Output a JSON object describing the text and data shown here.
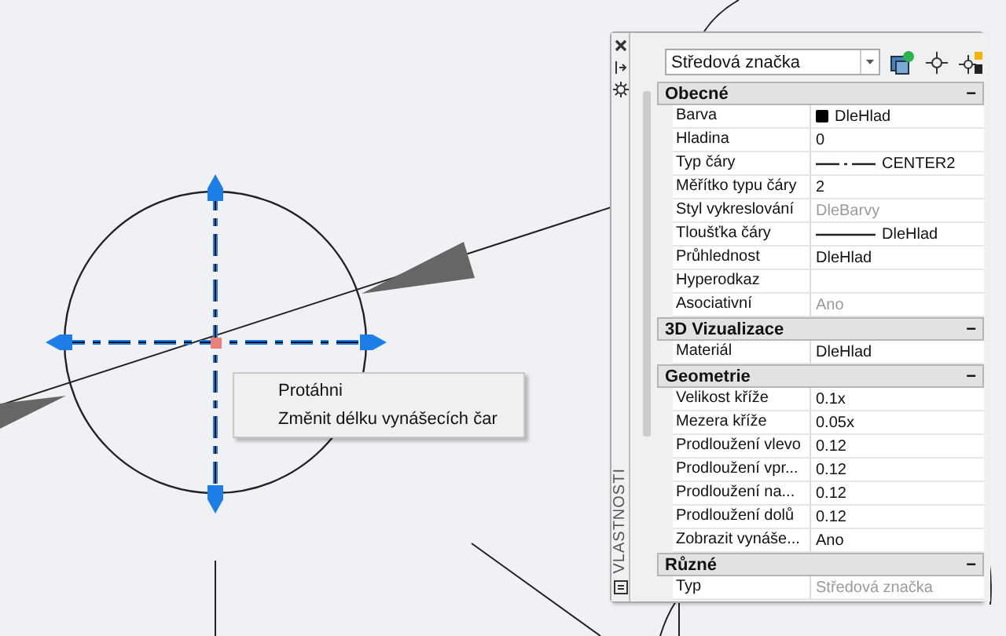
{
  "context_menu": {
    "items": [
      {
        "label": "Protáhni"
      },
      {
        "label": "Změnit délku vynášecích čar"
      }
    ]
  },
  "palette": {
    "title": "VLASTNOSTI",
    "object_type": "Středová značka",
    "sections": [
      {
        "title": "Obecné",
        "toggle": "−",
        "rows": [
          {
            "label": "Barva",
            "value": "DleHlad",
            "kind": "swatch",
            "disabled": false
          },
          {
            "label": "Hladina",
            "value": "0",
            "kind": "plain",
            "disabled": false
          },
          {
            "label": "Typ čáry",
            "value": "CENTER2",
            "kind": "linetype",
            "disabled": false
          },
          {
            "label": "Měřítko typu čáry",
            "value": "2",
            "kind": "plain",
            "disabled": false
          },
          {
            "label": "Styl vykreslování",
            "value": "DleBarvy",
            "kind": "plain",
            "disabled": true
          },
          {
            "label": "Tloušťka čáry",
            "value": "DleHlad",
            "kind": "lineweight",
            "disabled": false
          },
          {
            "label": "Průhlednost",
            "value": "DleHlad",
            "kind": "plain",
            "disabled": false
          },
          {
            "label": "Hyperodkaz",
            "kind": "plain"
          },
          {
            "label": "Asociativní",
            "value": "Ano",
            "kind": "plain",
            "disabled": true
          }
        ]
      },
      {
        "title": "3D Vizualizace",
        "toggle": "−",
        "rows": [
          {
            "label": "Materiál",
            "value": "DleHlad",
            "kind": "plain",
            "disabled": false
          }
        ]
      },
      {
        "title": "Geometrie",
        "toggle": "−",
        "rows": [
          {
            "label": "Velikost kříže",
            "value": "0.1x",
            "kind": "plain",
            "disabled": false
          },
          {
            "label": "Mezera kříže",
            "value": "0.05x",
            "kind": "plain",
            "disabled": false
          },
          {
            "label": "Prodloužení vlevo",
            "value": "0.12",
            "kind": "plain",
            "disabled": false
          },
          {
            "label": "Prodloužení vpr...",
            "value": "0.12",
            "kind": "plain",
            "disabled": false
          },
          {
            "label": "Prodloužení na...",
            "value": "0.12",
            "kind": "plain",
            "disabled": false
          },
          {
            "label": "Prodloužení dolů",
            "value": "0.12",
            "kind": "plain",
            "disabled": false
          },
          {
            "label": "Zobrazit vynáše...",
            "value": "Ano",
            "kind": "plain",
            "disabled": false
          }
        ]
      },
      {
        "title": "Různé",
        "toggle": "−",
        "rows": [
          {
            "label": "Typ",
            "value": "Středová značka",
            "kind": "plain",
            "disabled": true
          }
        ]
      }
    ]
  }
}
